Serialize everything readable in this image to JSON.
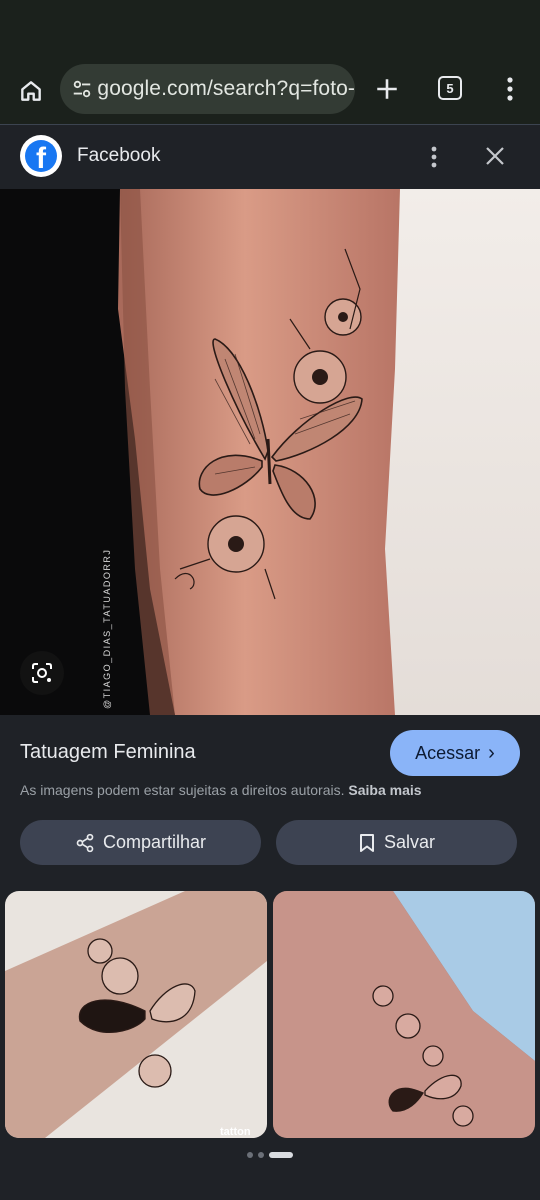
{
  "browser": {
    "url": "google.com/search?q=foto-",
    "tab_count": "5",
    "icons": {
      "home": "home-icon",
      "site_settings": "tune-icon",
      "new_tab": "plus-icon",
      "tabs": "tab-switcher-icon",
      "menu": "more-vert-icon"
    }
  },
  "source": {
    "name": "Facebook",
    "icons": {
      "logo": "facebook-logo-icon",
      "more": "more-vert-icon",
      "close": "close-icon"
    }
  },
  "main_image": {
    "watermark": "@TIAGO_DIAS_TATUADORRJ",
    "lens_icon": "lens-search-icon"
  },
  "result": {
    "title": "Tatuagem Feminina",
    "visit_label": "Acessar",
    "copyright_text": "As imagens podem estar sujeitas a direitos autorais.",
    "learn_more": "Saiba mais",
    "share_label": "Compartilhar",
    "save_label": "Salvar",
    "colors": {
      "visit_button": "#8ab4f8",
      "action_button": "#3d4352",
      "background": "#1f2227"
    }
  },
  "related": {
    "thumb1_caption": "tatton"
  },
  "pager": {
    "dots": 3,
    "active_index": 2
  }
}
